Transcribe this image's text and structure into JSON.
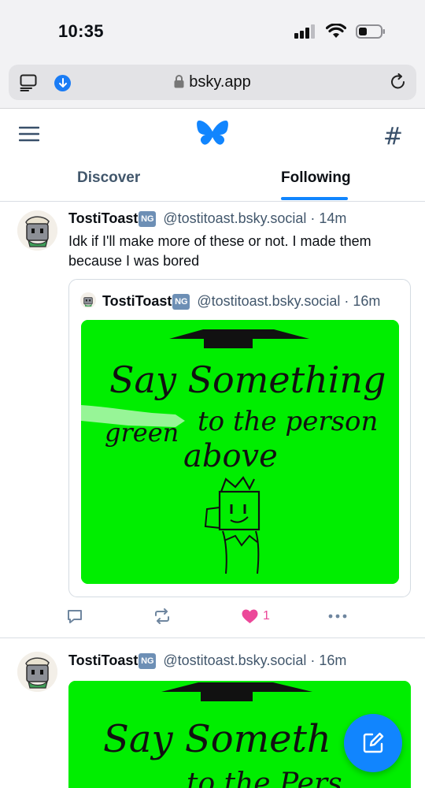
{
  "status_bar": {
    "time": "10:35"
  },
  "browser": {
    "url": "bsky.app"
  },
  "app_header": {
    "tabs": [
      {
        "label": "Discover",
        "active": false
      },
      {
        "label": "Following",
        "active": true
      }
    ],
    "icons": [
      "menu-icon",
      "butterfly-logo-icon",
      "hash-icon"
    ]
  },
  "posts": [
    {
      "author": "TostiToast",
      "badge": "NG",
      "handle": "@tostitoast.bsky.social",
      "separator": "·",
      "time": "14m",
      "text": "Idk if I'll make more of these or not. I made them because I was bored",
      "quote": {
        "author": "TostiToast",
        "badge": "NG",
        "handle": "@tostitoast.bsky.social",
        "separator": "·",
        "time": "16m",
        "image_text": [
          "Say Something",
          "green",
          "to the person",
          "above"
        ]
      },
      "actions": {
        "likes": "1",
        "liked": true
      }
    },
    {
      "author": "TostiToast",
      "badge": "NG",
      "handle": "@tostitoast.bsky.social",
      "separator": "·",
      "time": "16m",
      "image_text": [
        "Say Someth",
        "to the Pers"
      ]
    }
  ],
  "colors": {
    "accent": "#1185fe",
    "like": "#ec4899",
    "image_green": "#00ee00",
    "muted_text": "#42576c"
  }
}
